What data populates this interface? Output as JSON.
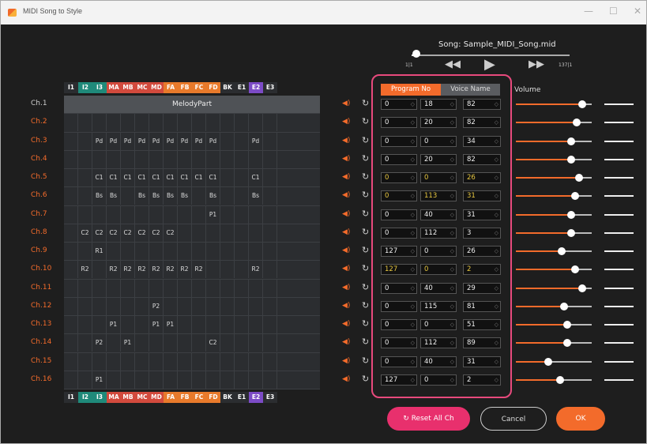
{
  "window": {
    "title": "MIDI Song to Style",
    "min": "—",
    "max": "☐",
    "close": "✕"
  },
  "song": {
    "label": "Song: Sample_MIDI_Song.mid",
    "bar_start": "1|1",
    "bar_end": "137|1",
    "progress": 0.05
  },
  "transport": {
    "rewind": "◀◀",
    "play": "▶",
    "forward": "▶▶"
  },
  "colors": {
    "accent": "#f36b2b",
    "highlight": "#e84a7d",
    "teal": "#1f8a7a",
    "red": "#d24a3d",
    "orange": "#e87a2b",
    "purple": "#7c4bc6",
    "gray": "#4f5256",
    "yellow": "#e6c640"
  },
  "parts": [
    "I1",
    "I2",
    "I3",
    "MA",
    "MB",
    "MC",
    "MD",
    "FA",
    "FB",
    "FC",
    "FD",
    "BK",
    "E1",
    "E2",
    "E3"
  ],
  "part_colors": [
    "#2b2d30",
    "#1f8a7a",
    "#1f8a7a",
    "#d24a3d",
    "#d24a3d",
    "#d24a3d",
    "#d24a3d",
    "#e87a2b",
    "#e87a2b",
    "#e87a2b",
    "#e87a2b",
    "#2b2d30",
    "#2b2d30",
    "#7c4bc6",
    "#2b2d30"
  ],
  "melody_label": "MelodyPart",
  "channels": [
    {
      "name": "Ch.1",
      "cells": [
        "",
        "",
        "",
        "",
        "",
        "",
        "",
        "",
        "",
        "",
        "",
        "",
        "",
        "",
        ""
      ],
      "program": "0",
      "msb": "18",
      "lsb": "82",
      "volume": 0.88,
      "highlight": false
    },
    {
      "name": "Ch.2",
      "cells": [
        "",
        "",
        "",
        "",
        "",
        "",
        "",
        "",
        "",
        "",
        "",
        "",
        "",
        "",
        ""
      ],
      "program": "0",
      "msb": "20",
      "lsb": "82",
      "volume": 0.8,
      "highlight": false
    },
    {
      "name": "Ch.3",
      "cells": [
        "",
        "",
        "Pd",
        "Pd",
        "Pd",
        "Pd",
        "Pd",
        "Pd",
        "Pd",
        "Pd",
        "Pd",
        "",
        "",
        "Pd",
        ""
      ],
      "program": "0",
      "msb": "0",
      "lsb": "34",
      "volume": 0.73,
      "highlight": false
    },
    {
      "name": "Ch.4",
      "cells": [
        "",
        "",
        "",
        "",
        "",
        "",
        "",
        "",
        "",
        "",
        "",
        "",
        "",
        "",
        ""
      ],
      "program": "0",
      "msb": "20",
      "lsb": "82",
      "volume": 0.73,
      "highlight": false
    },
    {
      "name": "Ch.5",
      "cells": [
        "",
        "",
        "C1",
        "C1",
        "C1",
        "C1",
        "C1",
        "C1",
        "C1",
        "C1",
        "C1",
        "",
        "",
        "C1",
        ""
      ],
      "program": "0",
      "msb": "0",
      "lsb": "26",
      "volume": 0.83,
      "highlight": true
    },
    {
      "name": "Ch.6",
      "cells": [
        "",
        "",
        "Bs",
        "Bs",
        "",
        "Bs",
        "Bs",
        "Bs",
        "Bs",
        "",
        "Bs",
        "",
        "",
        "Bs",
        ""
      ],
      "program": "0",
      "msb": "113",
      "lsb": "31",
      "volume": 0.78,
      "highlight": true
    },
    {
      "name": "Ch.7",
      "cells": [
        "",
        "",
        "",
        "",
        "",
        "",
        "",
        "",
        "",
        "",
        "P1",
        "",
        "",
        "",
        ""
      ],
      "program": "0",
      "msb": "40",
      "lsb": "31",
      "volume": 0.73,
      "highlight": false
    },
    {
      "name": "Ch.8",
      "cells": [
        "",
        "C2",
        "C2",
        "C2",
        "C2",
        "C2",
        "C2",
        "C2",
        "",
        "",
        "",
        "",
        "",
        "",
        ""
      ],
      "program": "0",
      "msb": "112",
      "lsb": "3",
      "volume": 0.73,
      "highlight": false
    },
    {
      "name": "Ch.9",
      "cells": [
        "",
        "",
        "R1",
        "",
        "",
        "",
        "",
        "",
        "",
        "",
        "",
        "",
        "",
        "",
        ""
      ],
      "program": "127",
      "msb": "0",
      "lsb": "26",
      "volume": 0.6,
      "highlight": false
    },
    {
      "name": "Ch.10",
      "cells": [
        "",
        "R2",
        "",
        "R2",
        "R2",
        "R2",
        "R2",
        "R2",
        "R2",
        "R2",
        "",
        "",
        "",
        "R2",
        ""
      ],
      "program": "127",
      "msb": "0",
      "lsb": "2",
      "volume": 0.78,
      "highlight": true
    },
    {
      "name": "Ch.11",
      "cells": [
        "",
        "",
        "",
        "",
        "",
        "",
        "",
        "",
        "",
        "",
        "",
        "",
        "",
        "",
        ""
      ],
      "program": "0",
      "msb": "40",
      "lsb": "29",
      "volume": 0.88,
      "highlight": false
    },
    {
      "name": "Ch.12",
      "cells": [
        "",
        "",
        "",
        "",
        "",
        "",
        "P2",
        "",
        "",
        "",
        "",
        "",
        "",
        "",
        ""
      ],
      "program": "0",
      "msb": "115",
      "lsb": "81",
      "volume": 0.64,
      "highlight": false
    },
    {
      "name": "Ch.13",
      "cells": [
        "",
        "",
        "",
        "P1",
        "",
        "",
        "P1",
        "P1",
        "",
        "",
        "",
        "",
        "",
        "",
        ""
      ],
      "program": "0",
      "msb": "0",
      "lsb": "51",
      "volume": 0.68,
      "highlight": false
    },
    {
      "name": "Ch.14",
      "cells": [
        "",
        "",
        "P2",
        "",
        "P1",
        "",
        "",
        "",
        "",
        "",
        "C2",
        "",
        "",
        "",
        ""
      ],
      "program": "0",
      "msb": "112",
      "lsb": "89",
      "volume": 0.68,
      "highlight": false
    },
    {
      "name": "Ch.15",
      "cells": [
        "",
        "",
        "",
        "",
        "",
        "",
        "",
        "",
        "",
        "",
        "",
        "",
        "",
        "",
        ""
      ],
      "program": "0",
      "msb": "40",
      "lsb": "31",
      "volume": 0.43,
      "highlight": false
    },
    {
      "name": "Ch.16",
      "cells": [
        "",
        "",
        "P1",
        "",
        "",
        "",
        "",
        "",
        "",
        "",
        "",
        "",
        "",
        "",
        ""
      ],
      "program": "127",
      "msb": "0",
      "lsb": "2",
      "volume": 0.58,
      "highlight": false
    }
  ],
  "tabs": {
    "program": "Program No",
    "voice": "Voice Name"
  },
  "volume_label": "Volume",
  "buttons": {
    "reset": "Reset All Ch",
    "cancel": "Cancel",
    "ok": "OK"
  }
}
